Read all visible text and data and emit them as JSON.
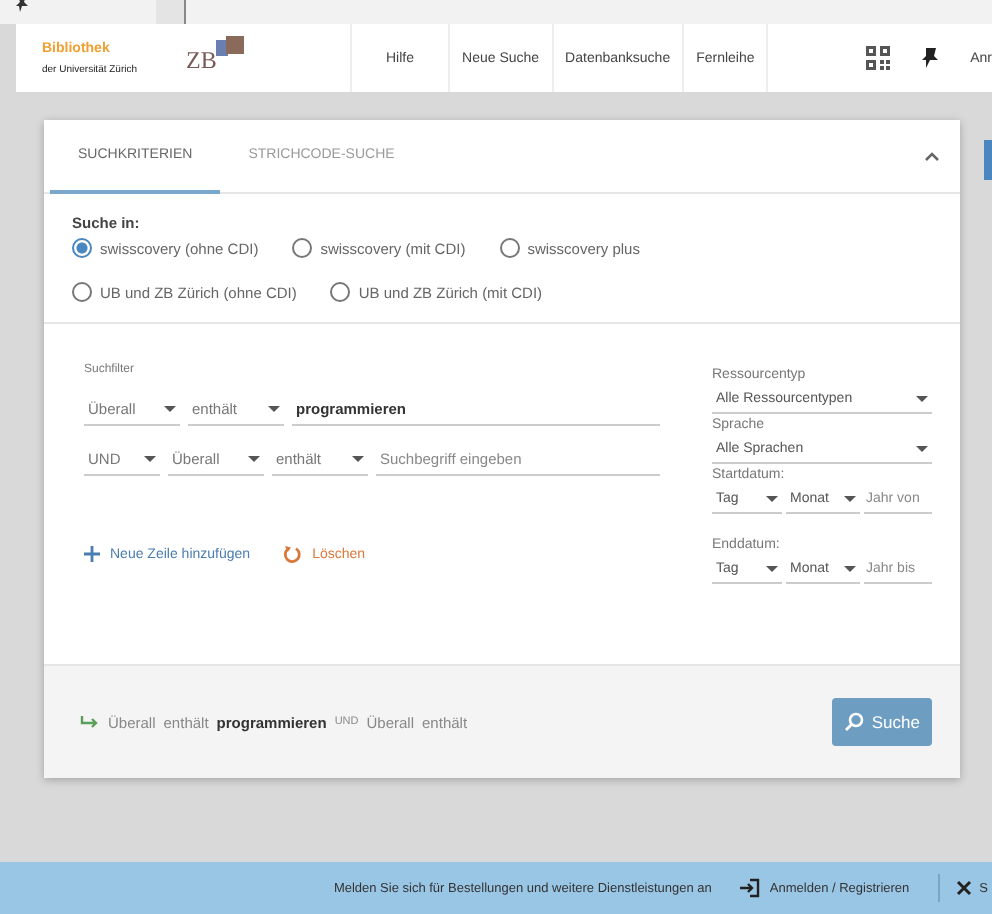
{
  "header": {
    "library_logo": {
      "title": "Bibliothek",
      "subtitle": "der Universität Zürich"
    },
    "zb_logo": "ZB",
    "nav": [
      {
        "label": "Hilfe"
      },
      {
        "label": "Neue Suche"
      },
      {
        "label": "Datenbanksuche"
      },
      {
        "label": "Fernleihe"
      }
    ],
    "user_label": "Anr"
  },
  "search_panel": {
    "tabs": [
      {
        "label": "SUCHKRITERIEN",
        "selected": true
      },
      {
        "label": "STRICHCODE-SUCHE",
        "selected": false
      }
    ],
    "search_in": {
      "label": "Suche in:",
      "options": [
        {
          "label": "swisscovery (ohne CDI)",
          "selected": true
        },
        {
          "label": "swisscovery (mit CDI)",
          "selected": false
        },
        {
          "label": "swisscovery plus",
          "selected": false
        },
        {
          "label": "UB und ZB Zürich (ohne CDI)",
          "selected": false
        },
        {
          "label": "UB und ZB Zürich (mit CDI)",
          "selected": false
        }
      ]
    },
    "filter": {
      "label": "Suchfilter",
      "rows": [
        {
          "field": "Überall",
          "condition": "enthält",
          "value": "programmieren"
        },
        {
          "operator": "UND",
          "field": "Überall",
          "condition": "enthält",
          "placeholder": "Suchbegriff eingeben"
        }
      ],
      "add_row": "Neue Zeile hinzufügen",
      "clear": "Löschen"
    },
    "resource_type": {
      "label": "Ressourcentyp",
      "value": "Alle Ressourcentypen"
    },
    "language": {
      "label": "Sprache",
      "value": "Alle Sprachen"
    },
    "start_date": {
      "label": "Startdatum:",
      "day": "Tag",
      "month": "Monat",
      "year_placeholder": "Jahr von"
    },
    "end_date": {
      "label": "Enddatum:",
      "day": "Tag",
      "month": "Monat",
      "year_placeholder": "Jahr bis"
    },
    "summary": [
      {
        "kind": "field",
        "text": "Überall"
      },
      {
        "kind": "condition",
        "text": "enthält"
      },
      {
        "kind": "value",
        "text": "programmieren"
      },
      {
        "kind": "operator",
        "text": "UND"
      },
      {
        "kind": "field",
        "text": "Überall"
      },
      {
        "kind": "condition",
        "text": "enthält"
      }
    ],
    "search_button": "Suche"
  },
  "banner": {
    "message": "Melden Sie sich für Bestellungen und weitere Dienstleistungen an",
    "login": "Anmelden / Registrieren",
    "close_label": "S"
  }
}
